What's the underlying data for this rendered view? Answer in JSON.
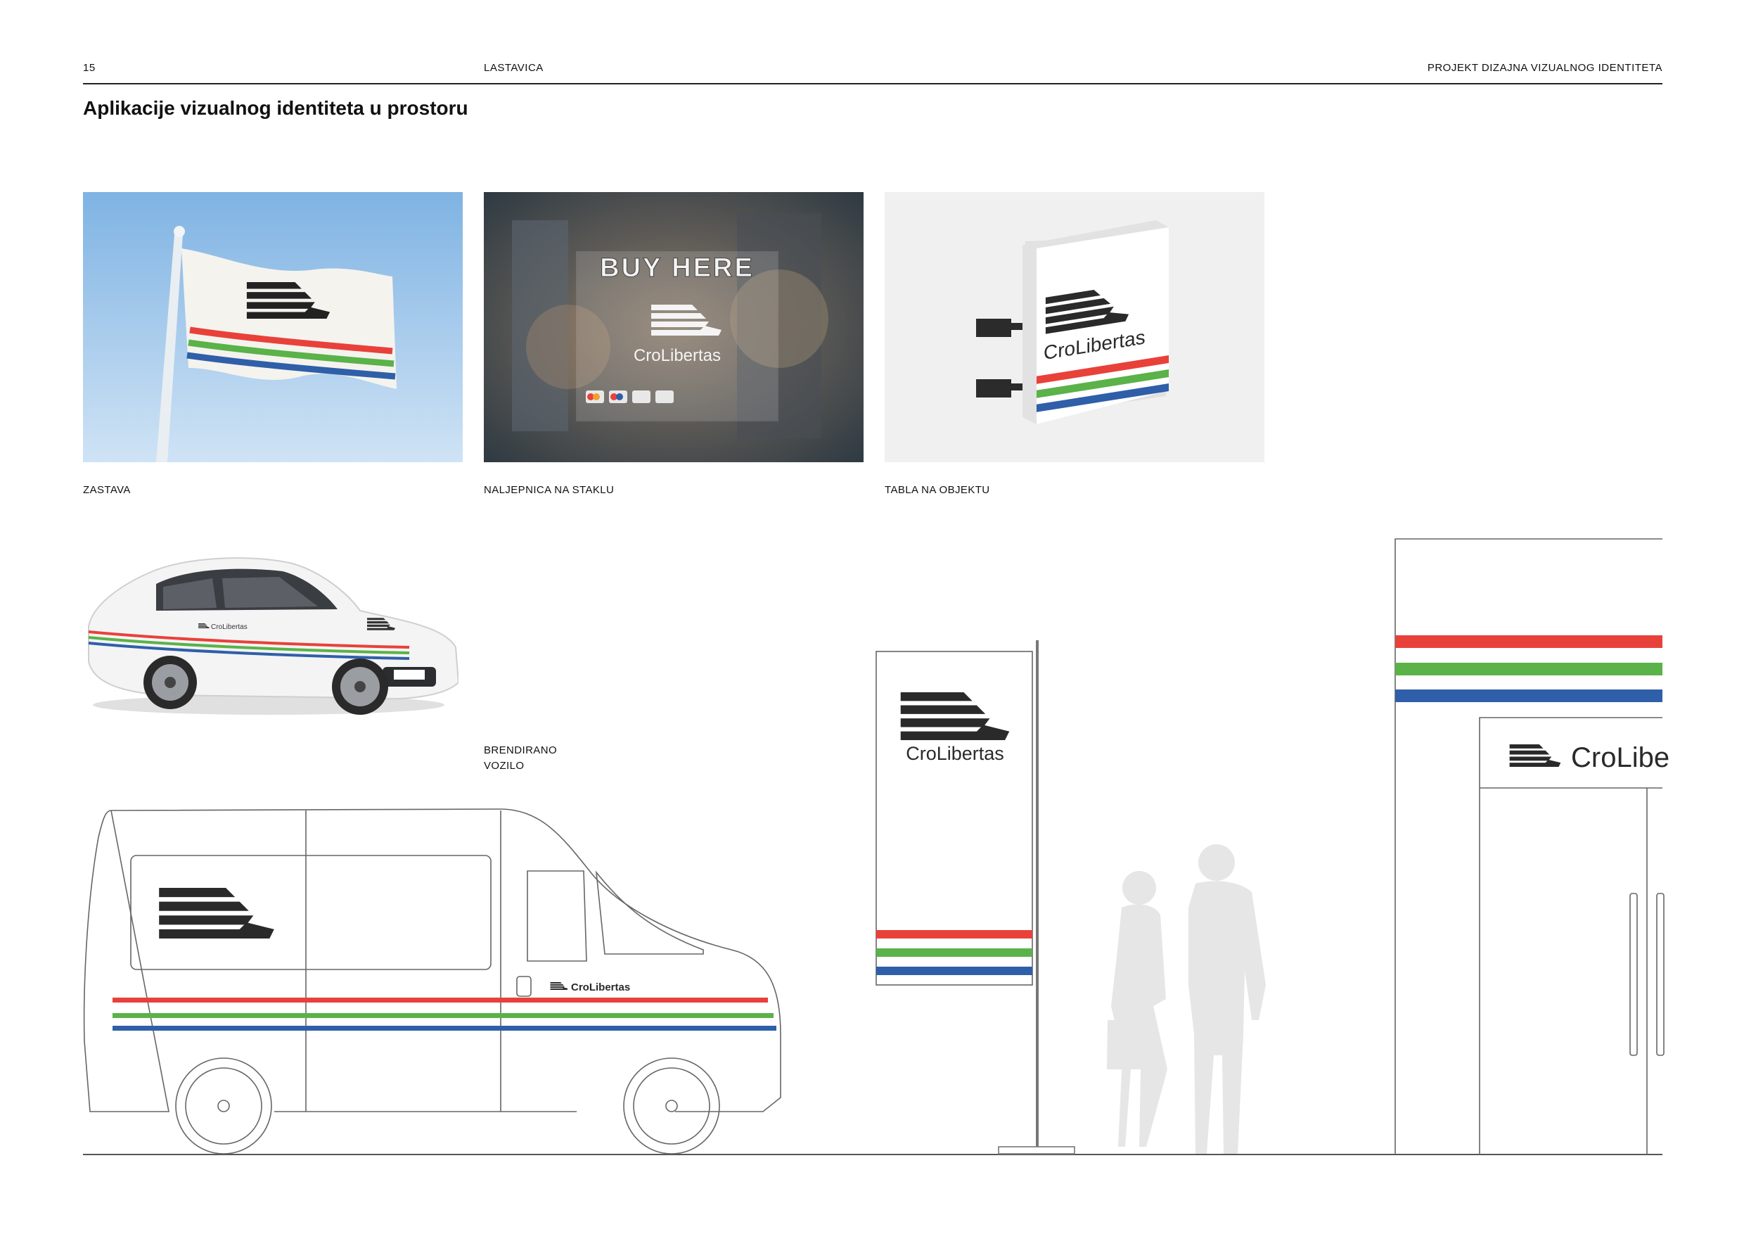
{
  "header": {
    "page_number": "15",
    "section": "LASTAVICA",
    "doc_title": "PROJEKT DIZAJNA VIZUALNOG IDENTITETA"
  },
  "page_title": "Aplikacije vizualnog identiteta u prostoru",
  "brand": {
    "name": "CroLibertas",
    "name_partial": "CroLibe",
    "colors": {
      "red": "#e8413a",
      "green": "#5ab249",
      "blue": "#2f5fa8",
      "ink": "#2a2a2a"
    }
  },
  "items": {
    "flag_caption": "ZASTAVA",
    "glass_caption": "NALJEPNICA NA STAKLU",
    "glass_headline": "BUY HERE",
    "sign_caption": "TABLA NA OBJEKTU",
    "vehicle_caption_line1": "BRENDIRANO",
    "vehicle_caption_line2": "VOZILO"
  }
}
